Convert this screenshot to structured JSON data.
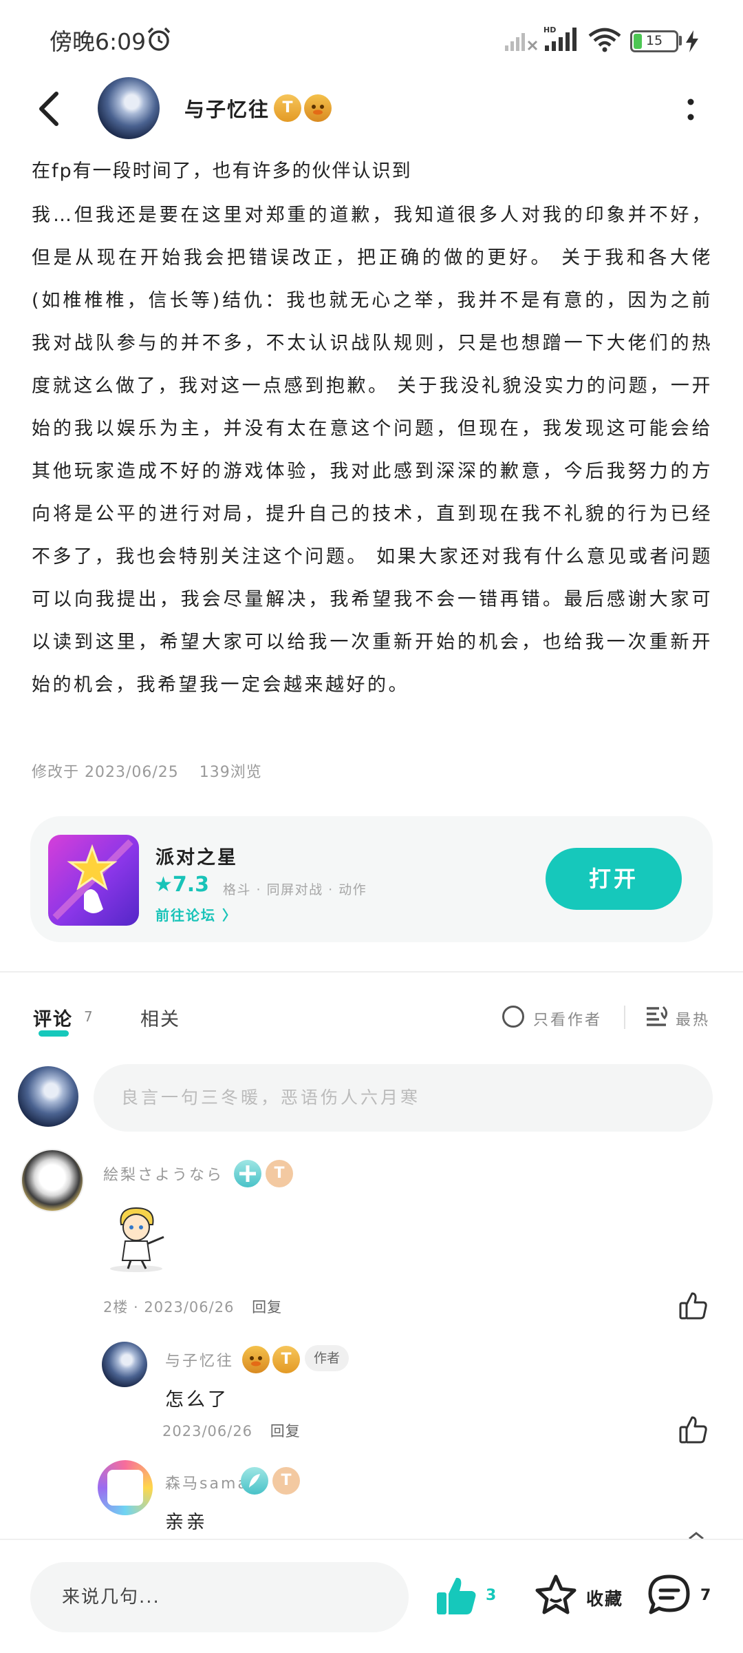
{
  "status_bar": {
    "time": "傍晚6:09",
    "battery": "15",
    "network": "HD"
  },
  "header": {
    "author_name": "与子忆往",
    "badge_t": "T"
  },
  "post": {
    "title": "在fp有一段时间了，也有许多的伙伴认识到",
    "body": "我…但我还是要在这里对郑重的道歉，我知道很多人对我的印象并不好，但是从现在开始我会把错误改正，把正确的做的更好。 关于我和各大佬(如椎椎椎，信长等)结仇：我也就无心之举，我并不是有意的，因为之前我对战队参与的并不多，不太认识战队规则，只是也想蹭一下大佬们的热度就这么做了，我对这一点感到抱歉。 关于我没礼貌没实力的问题，一开始的我以娱乐为主，并没有太在意这个问题，但现在，我发现这可能会给其他玩家造成不好的游戏体验，我对此感到深深的歉意，今后我努力的方向将是公平的进行对局，提升自己的技术，直到现在我不礼貌的行为已经不多了，我也会特别关注这个问题。 如果大家还对我有什么意见或者问题可以向我提出，我会尽量解决，我希望我不会一错再错。最后感谢大家可以读到这里，希望大家可以给我一次重新开始的机会，也给我一次重新开始的机会，我希望我一定会越来越好的。",
    "modified": "修改于 2023/06/25",
    "views": "139浏览"
  },
  "game_card": {
    "name": "派对之星",
    "rating": "★7.3",
    "tags": "格斗 · 同屏对战 · 动作",
    "forum_link": "前往论坛 〉",
    "open_label": "打开"
  },
  "comment_tabs": {
    "comments_label": "评论",
    "comments_count": "7",
    "related_label": "相关",
    "only_author_label": "只看作者",
    "sort_label": "最热"
  },
  "comment_box": {
    "placeholder": "良言一句三冬暖，恶语伤人六月寒"
  },
  "comments": [
    {
      "name": "絵梨さようなら",
      "badge_t": "T",
      "floor": "2楼 · 2023/06/26",
      "reply_label": "回复",
      "replies": [
        {
          "name": "与子忆往",
          "badge_t": "T",
          "author_tag": "作者",
          "text": "怎么了",
          "date": "2023/06/26",
          "reply_label": "回复"
        },
        {
          "name": "森马sama",
          "badge_t": "T",
          "text": "亲亲"
        }
      ]
    }
  ],
  "bottom_bar": {
    "input_placeholder": "来说几句...",
    "like_count": "3",
    "favorite_label": "收藏",
    "comment_count": "7"
  },
  "colors": {
    "accent": "#16c8bb",
    "text": "#222222",
    "muted": "#999999",
    "card_bg": "#f5f7f7"
  }
}
